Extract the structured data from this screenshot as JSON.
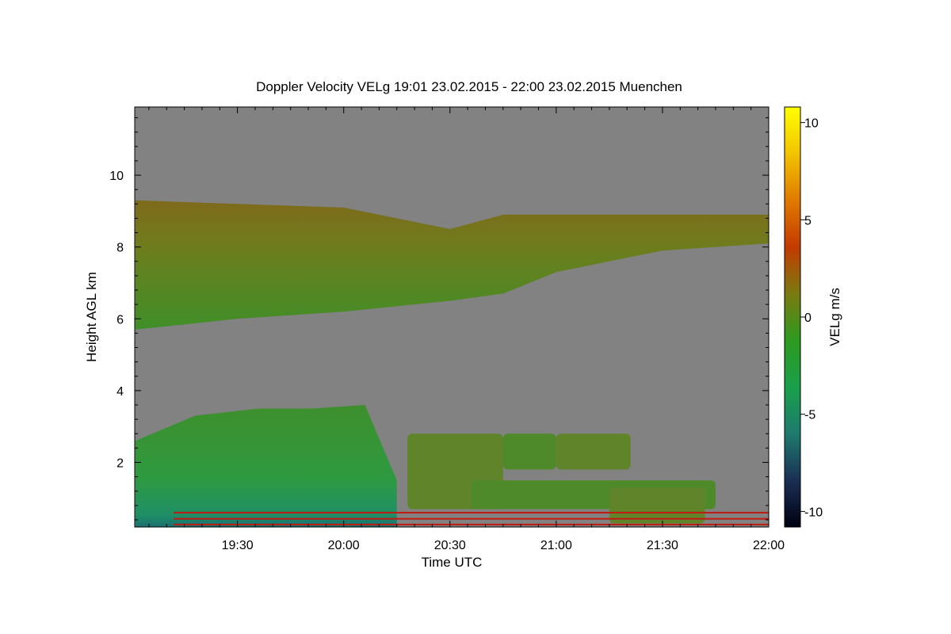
{
  "chart_data": {
    "type": "heatmap",
    "title": "Doppler Velocity VELg   19:01 23.02.2015 - 22:00 23.02.2015 Muenchen",
    "xlabel": "Time UTC",
    "ylabel": "Height AGL km",
    "colorbar_label": "VELg m/s",
    "x_range": [
      "19:01",
      "22:00"
    ],
    "x_ticks": [
      "19:30",
      "20:00",
      "20:30",
      "21:00",
      "21:30",
      "22:00"
    ],
    "y_range_km": [
      0.2,
      11.9
    ],
    "y_ticks": [
      2,
      4,
      6,
      8,
      10
    ],
    "colorbar_range": [
      -10.8,
      10.8
    ],
    "colorbar_ticks": [
      10,
      5,
      0,
      -5,
      -10
    ],
    "colorscale": [
      "#000010",
      "#1a2f55",
      "#1e7a6e",
      "#1aa04a",
      "#2d9a20",
      "#7a7a10",
      "#c43a00",
      "#e07a00",
      "#f3c400",
      "#ffff00"
    ],
    "background_color": "#828282",
    "regions": [
      {
        "name": "upper cloud layer",
        "velocity_ms": -1.0,
        "top_km": [
          [
            19.02,
            9.3
          ],
          [
            19.5,
            9.2
          ],
          [
            20.0,
            9.1
          ],
          [
            20.5,
            8.5
          ],
          [
            20.75,
            8.9
          ],
          [
            21.0,
            8.9
          ],
          [
            21.5,
            8.9
          ],
          [
            22.0,
            8.9
          ]
        ],
        "base_km": [
          [
            19.02,
            5.7
          ],
          [
            19.5,
            6.0
          ],
          [
            20.0,
            6.2
          ],
          [
            20.5,
            6.5
          ],
          [
            20.75,
            6.7
          ],
          [
            21.0,
            7.3
          ],
          [
            21.5,
            7.9
          ],
          [
            22.0,
            8.1
          ]
        ]
      },
      {
        "name": "lower precipitation layer",
        "velocity_ms": -2.0,
        "top_km": [
          [
            19.02,
            2.6
          ],
          [
            19.3,
            3.3
          ],
          [
            19.6,
            3.5
          ],
          [
            19.85,
            3.5
          ],
          [
            20.1,
            3.6
          ],
          [
            20.25,
            1.5
          ]
        ],
        "base_km": [
          [
            19.02,
            0.2
          ],
          [
            20.25,
            0.2
          ]
        ]
      },
      {
        "name": "scattered low clouds",
        "velocity_ms": -1.0,
        "patches": [
          {
            "t": [
              20.3,
              20.75
            ],
            "h": [
              0.7,
              2.8
            ]
          },
          {
            "t": [
              20.75,
              21.0
            ],
            "h": [
              1.8,
              2.8
            ]
          },
          {
            "t": [
              21.0,
              21.35
            ],
            "h": [
              1.8,
              2.8
            ]
          },
          {
            "t": [
              20.6,
              21.75
            ],
            "h": [
              0.7,
              1.5
            ]
          },
          {
            "t": [
              21.25,
              21.7
            ],
            "h": [
              0.3,
              1.3
            ]
          }
        ]
      },
      {
        "name": "near-surface clutter lines",
        "velocity_ms": 1.5,
        "heights_km": [
          0.27,
          0.43,
          0.6
        ]
      }
    ]
  }
}
